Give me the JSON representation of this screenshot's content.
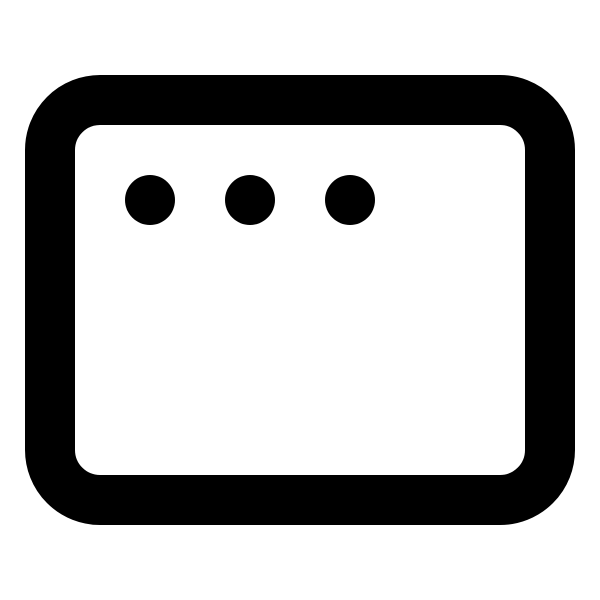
{
  "icon": {
    "name": "browser-window-icon",
    "stroke_color": "#000000",
    "fill_color": "#ffffff",
    "background": "#ffffff",
    "dot_count": 3
  }
}
